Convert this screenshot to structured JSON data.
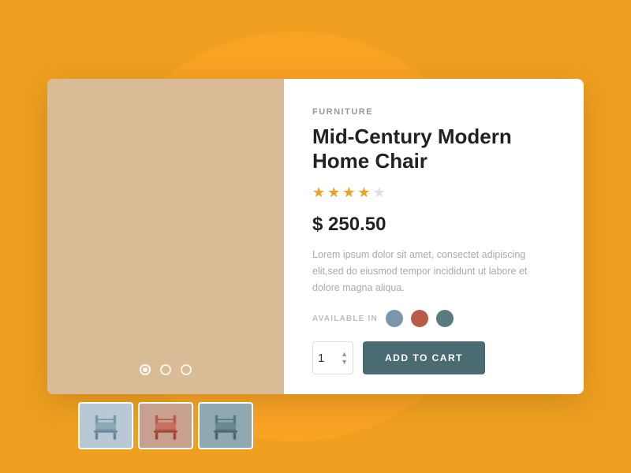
{
  "background": {
    "color": "#F0A020"
  },
  "product": {
    "category": "FURNITURE",
    "title": "Mid-Century Modern Home Chair",
    "rating": 4,
    "max_rating": 5,
    "price": "$ 250.50",
    "description": "Lorem ipsum dolor sit amet, consectet adipiscing elit,sed do eiusmod tempor incididunt ut labore et dolore magna aliqua.",
    "available_label": "AVAILABLE IN",
    "colors": [
      {
        "name": "blue",
        "hex": "#7A96A8"
      },
      {
        "name": "red",
        "hex": "#B85C48"
      },
      {
        "name": "teal",
        "hex": "#5A7A82"
      }
    ],
    "quantity": 1,
    "add_cart_label": "ADD TO CART"
  },
  "carousel": {
    "dots": [
      {
        "active": true
      },
      {
        "active": false
      },
      {
        "active": false
      }
    ],
    "thumbnails": [
      {
        "color": "blue-grey",
        "label": "Chair variant 1"
      },
      {
        "color": "rust",
        "label": "Chair variant 2"
      },
      {
        "color": "teal-grey",
        "label": "Chair variant 3"
      }
    ]
  },
  "stars": [
    "★",
    "★",
    "★",
    "★",
    "☆"
  ]
}
